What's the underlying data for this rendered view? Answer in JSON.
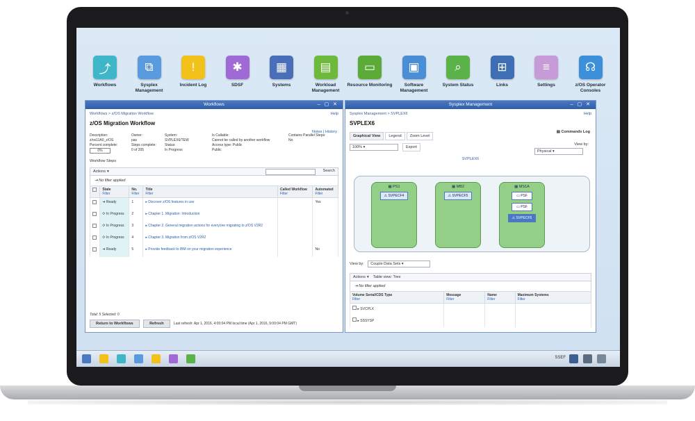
{
  "launcher": [
    {
      "label": "Workflows",
      "color": "#3fb6c7",
      "icon": "workflow-icon",
      "glyph": "⤴"
    },
    {
      "label": "Sysplex Management",
      "color": "#5a9be0",
      "icon": "sysplex-icon",
      "glyph": "⧉"
    },
    {
      "label": "Incident Log",
      "color": "#f2c21b",
      "icon": "warning-icon",
      "glyph": "!"
    },
    {
      "label": "SDSF",
      "color": "#a06ad6",
      "icon": "puzzle-icon",
      "glyph": "✱"
    },
    {
      "label": "Systems",
      "color": "#4a6fb8",
      "icon": "systems-icon",
      "glyph": "▦"
    },
    {
      "label": "Workload Management",
      "color": "#6cb93b",
      "icon": "workload-icon",
      "glyph": "▤"
    },
    {
      "label": "Resource Monitoring",
      "color": "#5cab38",
      "icon": "monitor-icon",
      "glyph": "▭"
    },
    {
      "label": "Software Management",
      "color": "#4a8fd6",
      "icon": "software-icon",
      "glyph": "▣"
    },
    {
      "label": "System Status",
      "color": "#5ab248",
      "icon": "status-search-icon",
      "glyph": "⌕"
    },
    {
      "label": "Links",
      "color": "#3e6fb5",
      "icon": "links-icon",
      "glyph": "⊞"
    },
    {
      "label": "Settings",
      "color": "#c79ad8",
      "icon": "settings-icon",
      "glyph": "≡"
    },
    {
      "label": "z/OS Operator Consoles",
      "color": "#3c8fd9",
      "icon": "headset-icon",
      "glyph": "☊"
    }
  ],
  "workflows": {
    "window_title": "Workflows",
    "breadcrumb": "Workflows  >  z/OS Migration Workflow",
    "help": "Help",
    "title": "z/OS Migration Workflow",
    "notes_link": "Notes  |  History",
    "meta": [
      [
        "Description:",
        "Owner:",
        "System:",
        "Is Callable:",
        "Contains Parallel Steps:"
      ],
      [
        "z/os11A0_z/OS",
        "pas",
        "SVPLEX6/TEW",
        "Cannot be called by another workflow",
        "No"
      ],
      [
        "Percent complete:",
        "Steps complete:",
        "Status:",
        "Access type: Public",
        ""
      ]
    ],
    "percent": "0%",
    "steps_done": "0 of 205",
    "status": "In Progress",
    "access": "Public",
    "steps_label": "Workflow Steps",
    "actions": "Actions",
    "search": "Search",
    "no_filter": "No filter applied",
    "columns": [
      "State",
      "No.",
      "Title",
      "Called Workflow",
      "Automated"
    ],
    "filter": "Filter",
    "rows": [
      {
        "state": "Ready",
        "no": "1",
        "title": "Discover z/OS features in use",
        "called": "",
        "auto": "Yes"
      },
      {
        "state": "In Progress",
        "no": "2",
        "title": "Chapter 1. Migration: Introduction",
        "called": "",
        "auto": ""
      },
      {
        "state": "In Progress",
        "no": "3",
        "title": "Chapter 2. General migration actions for everyone migrating to z/OS V2R2",
        "called": "",
        "auto": ""
      },
      {
        "state": "In Progress",
        "no": "4",
        "title": "Chapter 3. Migration from z/OS V2R2",
        "called": "",
        "auto": ""
      },
      {
        "state": "Ready",
        "no": "5",
        "title": "Provide feedback to IBM on your migration experience",
        "called": "",
        "auto": "No"
      }
    ],
    "total": "Total: 5   Selected: 0",
    "return_btn": "Return to Workflows",
    "refresh_btn": "Refresh",
    "last_refresh": "Last refresh: Apr 1, 2016, 4:00:04 PM local time (Apr 1, 2016, 9:00:04 PM GMT)"
  },
  "sysplex": {
    "window_title": "Sysplex Management",
    "breadcrumb": "Sysplex Management  >  SVPLEX6",
    "help": "Help",
    "title": "SVPLEX6",
    "commands_log": "Commands Log",
    "tabs": [
      "Graphical View",
      "Legend",
      "Zoom Level"
    ],
    "zoom": "100%",
    "export": "Export",
    "viewby_label": "View by:",
    "viewby": "Physical",
    "plex_name": "SVPLEX6",
    "lpars": [
      {
        "name": "PS1",
        "cf": [
          "SVPECF4"
        ]
      },
      {
        "name": "MB2",
        "cf": [
          "SVPECF5"
        ]
      },
      {
        "name": "MS1A",
        "cf": [
          "PSF",
          "PSF",
          "SVPECF5"
        ]
      }
    ],
    "view_by2": "View by:",
    "couple_sets": "Couple Data Sets",
    "actions": "Actions",
    "table_view": "Table view: Tree",
    "no_filter": "No filter applied",
    "columns": [
      "Volume Serial/CDS Type",
      "Message",
      "Name",
      "Maximum Systems"
    ],
    "filter": "Filter",
    "rows": [
      "SVCPLX",
      "SSSYSP"
    ]
  },
  "taskbar": {
    "time": "SSEF",
    "colors": [
      "#4a78c2",
      "#f2c21b",
      "#3fb6c7",
      "#5a9be0",
      "#f2c21b",
      "#a06ad6",
      "#5ab248"
    ]
  }
}
